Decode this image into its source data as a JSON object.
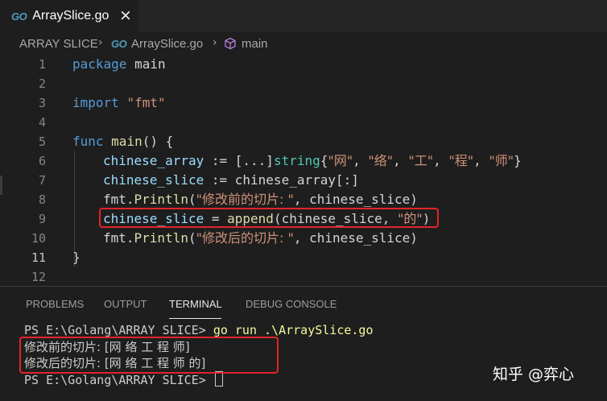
{
  "tab": {
    "icon": "GO",
    "title": "ArraySlice.go",
    "close": "×"
  },
  "breadcrumb": {
    "root": "ARRAY SLICE",
    "sep": "›",
    "file_icon": "GO",
    "file": "ArraySlice.go",
    "symbol": "main"
  },
  "editor": {
    "line_numbers": [
      "1",
      "2",
      "3",
      "4",
      "5",
      "6",
      "7",
      "8",
      "9",
      "10",
      "11",
      "12"
    ],
    "active_line": "11",
    "lines": {
      "l1": {
        "kw": "package",
        "name": "main"
      },
      "l3": {
        "kw": "import",
        "str": "\"fmt\""
      },
      "l5": {
        "kw": "func",
        "fn": "main",
        "rest": "() {"
      },
      "l6": {
        "var": "chinese_array",
        "op": " := [...]",
        "type": "string",
        "open": "{",
        "s1": "\"网\"",
        "s2": "\"络\"",
        "s3": "\"工\"",
        "s4": "\"程\"",
        "s5": "\"师\"",
        "close": "}",
        "sep": ", "
      },
      "l7": {
        "var": "chinese_slice",
        "op": " := ",
        "rest": "chinese_array[:]"
      },
      "l8": {
        "pkg": "fmt.",
        "fn": "Println",
        "open": "(",
        "str": "\"修改前的切片: \"",
        "rest": ", chinese_slice)"
      },
      "l9": {
        "var": "chinese_slice",
        "op": " = ",
        "fn": "append",
        "rest1": "(chinese_slice, ",
        "str": "\"的\"",
        "close": ")"
      },
      "l10": {
        "pkg": "fmt.",
        "fn": "Println",
        "open": "(",
        "str": "\"修改后的切片: \"",
        "rest": ", chinese_slice)"
      },
      "l11": {
        "close": "}"
      }
    }
  },
  "panel": {
    "tabs": [
      "PROBLEMS",
      "OUTPUT",
      "TERMINAL",
      "DEBUG CONSOLE"
    ],
    "active_tab": "TERMINAL",
    "terminal": {
      "prompt": "PS E:\\Golang\\ARRAY SLICE> ",
      "command": "go run .\\ArraySlice.go",
      "out1": "修改前的切片: [网 络 工 程 师]",
      "out2": "修改后的切片: [网 络 工 程 师 的]",
      "prompt2": "PS E:\\Golang\\ARRAY SLICE> "
    }
  },
  "watermark": "知乎 @弈心",
  "colors": {
    "highlight_box": "#e2242b",
    "keyword": "#569cd6",
    "function": "#dcdcaa",
    "variable": "#9cdcfe",
    "string": "#ce9178",
    "type": "#4ec9b0"
  }
}
